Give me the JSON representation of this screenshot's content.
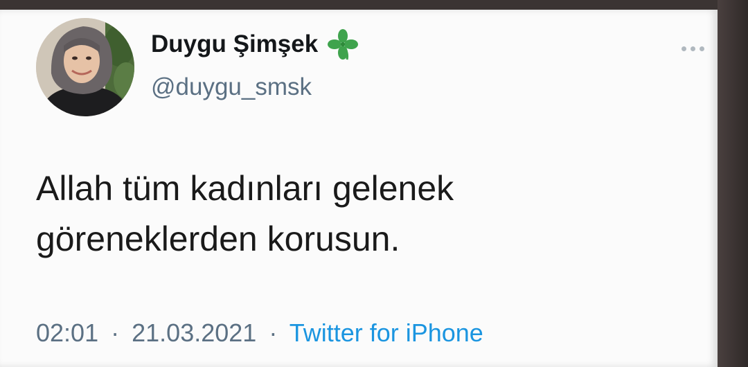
{
  "tweet": {
    "display_name": "Duygu Şimşek",
    "handle": "@duygu_smsk",
    "text_lines": [
      "Allah tüm kadınları gelenek",
      "göreneklerden korusun."
    ],
    "time": "02:01",
    "date": "21.03.2021",
    "source": "Twitter for iPhone",
    "separator": "·"
  },
  "icons": {
    "badge": "four-leaf-clover-icon",
    "menu": "more-options-icon"
  },
  "colors": {
    "name": "#14171a",
    "secondary": "#5b7083",
    "link": "#1b95e0",
    "clover": "#3fa34d"
  }
}
